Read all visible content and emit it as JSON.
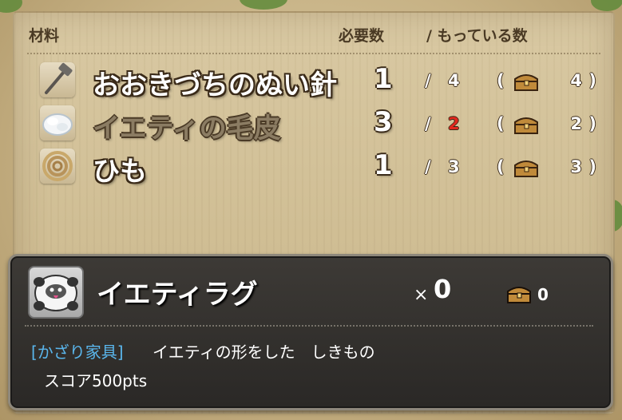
{
  "header": {
    "col_material": "材料",
    "col_required": "必要数",
    "col_have": "/ もっている数"
  },
  "materials": [
    {
      "name": "おおきづちのぬい針",
      "icon": "mallet-needle-icon",
      "required": "1",
      "sep": "/",
      "have": "4",
      "short": false,
      "storage_open": "(",
      "storage": "4",
      "storage_close": ")"
    },
    {
      "name": "イエティの毛皮",
      "icon": "white-fur-icon",
      "required": "3",
      "sep": "/",
      "have": "2",
      "short": true,
      "storage_open": "(",
      "storage": "2",
      "storage_close": ")"
    },
    {
      "name": "ひも",
      "icon": "rope-coil-icon",
      "required": "1",
      "sep": "/",
      "have": "3",
      "short": false,
      "storage_open": "(",
      "storage": "3",
      "storage_close": ")"
    }
  ],
  "product": {
    "name": "イエティラグ",
    "icon": "yeti-rug-icon",
    "qty_prefix": "×",
    "qty": "0",
    "storage_count": "0",
    "category": "[かざり家具]",
    "description": "イエティの形をした　しきもの",
    "score": "スコア500pts"
  },
  "colors": {
    "shortage": "#e0281e",
    "category": "#5ab6ec",
    "parchment": "#d2c29a",
    "panel": "#2f2d2b"
  }
}
